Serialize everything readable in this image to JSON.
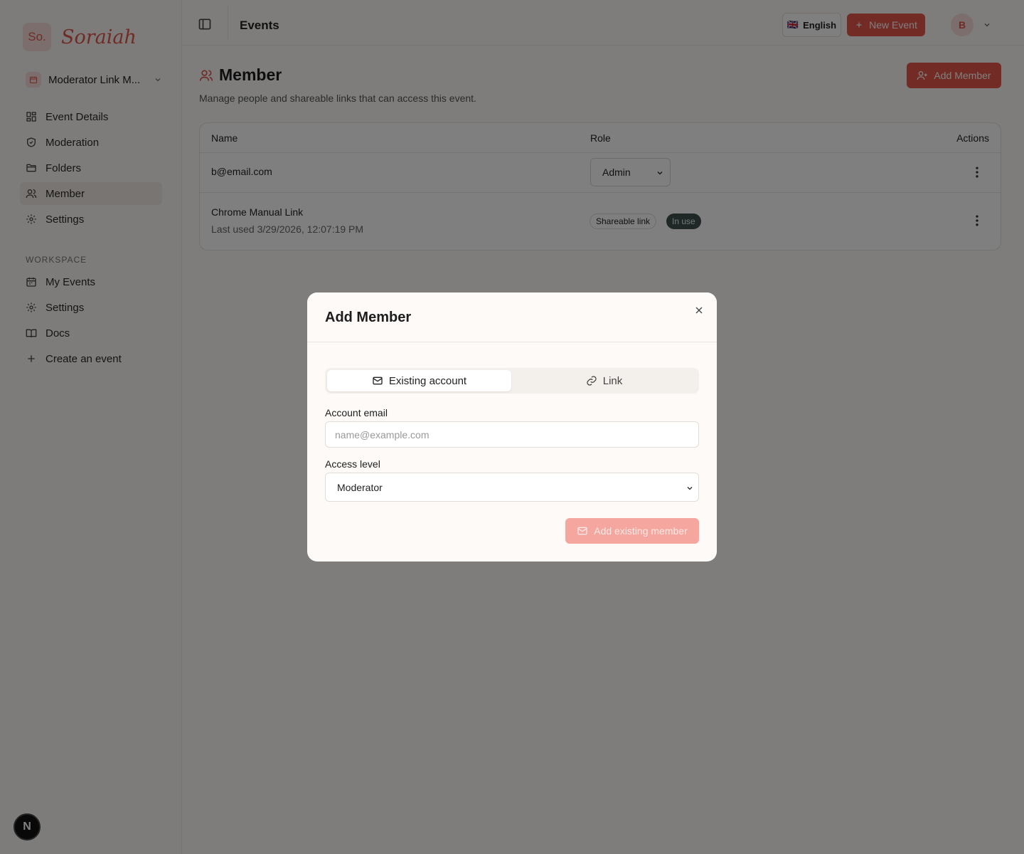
{
  "brand": {
    "badge": "So.",
    "name": "Soraiah"
  },
  "event_switcher": {
    "label": "Moderator Link M..."
  },
  "sidebar": {
    "event_items": [
      {
        "label": "Event Details",
        "icon": "grid-icon"
      },
      {
        "label": "Moderation",
        "icon": "shield-icon"
      },
      {
        "label": "Folders",
        "icon": "folder-icon"
      },
      {
        "label": "Member",
        "icon": "users-icon",
        "active": true
      },
      {
        "label": "Settings",
        "icon": "gear-icon"
      }
    ],
    "workspace_label": "WORKSPACE",
    "workspace_items": [
      {
        "label": "My Events",
        "icon": "calendar-icon"
      },
      {
        "label": "Settings",
        "icon": "gear-icon"
      },
      {
        "label": "Docs",
        "icon": "book-icon"
      },
      {
        "label": "Create an event",
        "icon": "plus-icon"
      }
    ]
  },
  "next_badge": "N",
  "topbar": {
    "title": "Events",
    "language": "English",
    "language_flag": "🇬🇧",
    "new_event": "New Event",
    "avatar_initial": "B"
  },
  "page": {
    "title": "Member",
    "description": "Manage people and shareable links that can access this event.",
    "add_member": "Add Member"
  },
  "table": {
    "headers": {
      "name": "Name",
      "role": "Role",
      "actions": "Actions"
    },
    "rows": [
      {
        "name": "b@email.com",
        "role": "Admin"
      },
      {
        "name": "Chrome Manual Link",
        "subtitle": "Last used 3/29/2026, 12:07:19 PM",
        "type_badge": "Shareable link",
        "status_badge": "In use"
      }
    ]
  },
  "modal": {
    "title": "Add Member",
    "tabs": {
      "existing": "Existing account",
      "link": "Link"
    },
    "email_label": "Account email",
    "email_placeholder": "name@example.com",
    "email_value": "",
    "access_label": "Access level",
    "access_value": "Moderator",
    "submit": "Add existing member"
  },
  "colors": {
    "accent": "#e4574a",
    "accent_disabled": "#f4a69f",
    "status_dark": "#3f514e"
  }
}
